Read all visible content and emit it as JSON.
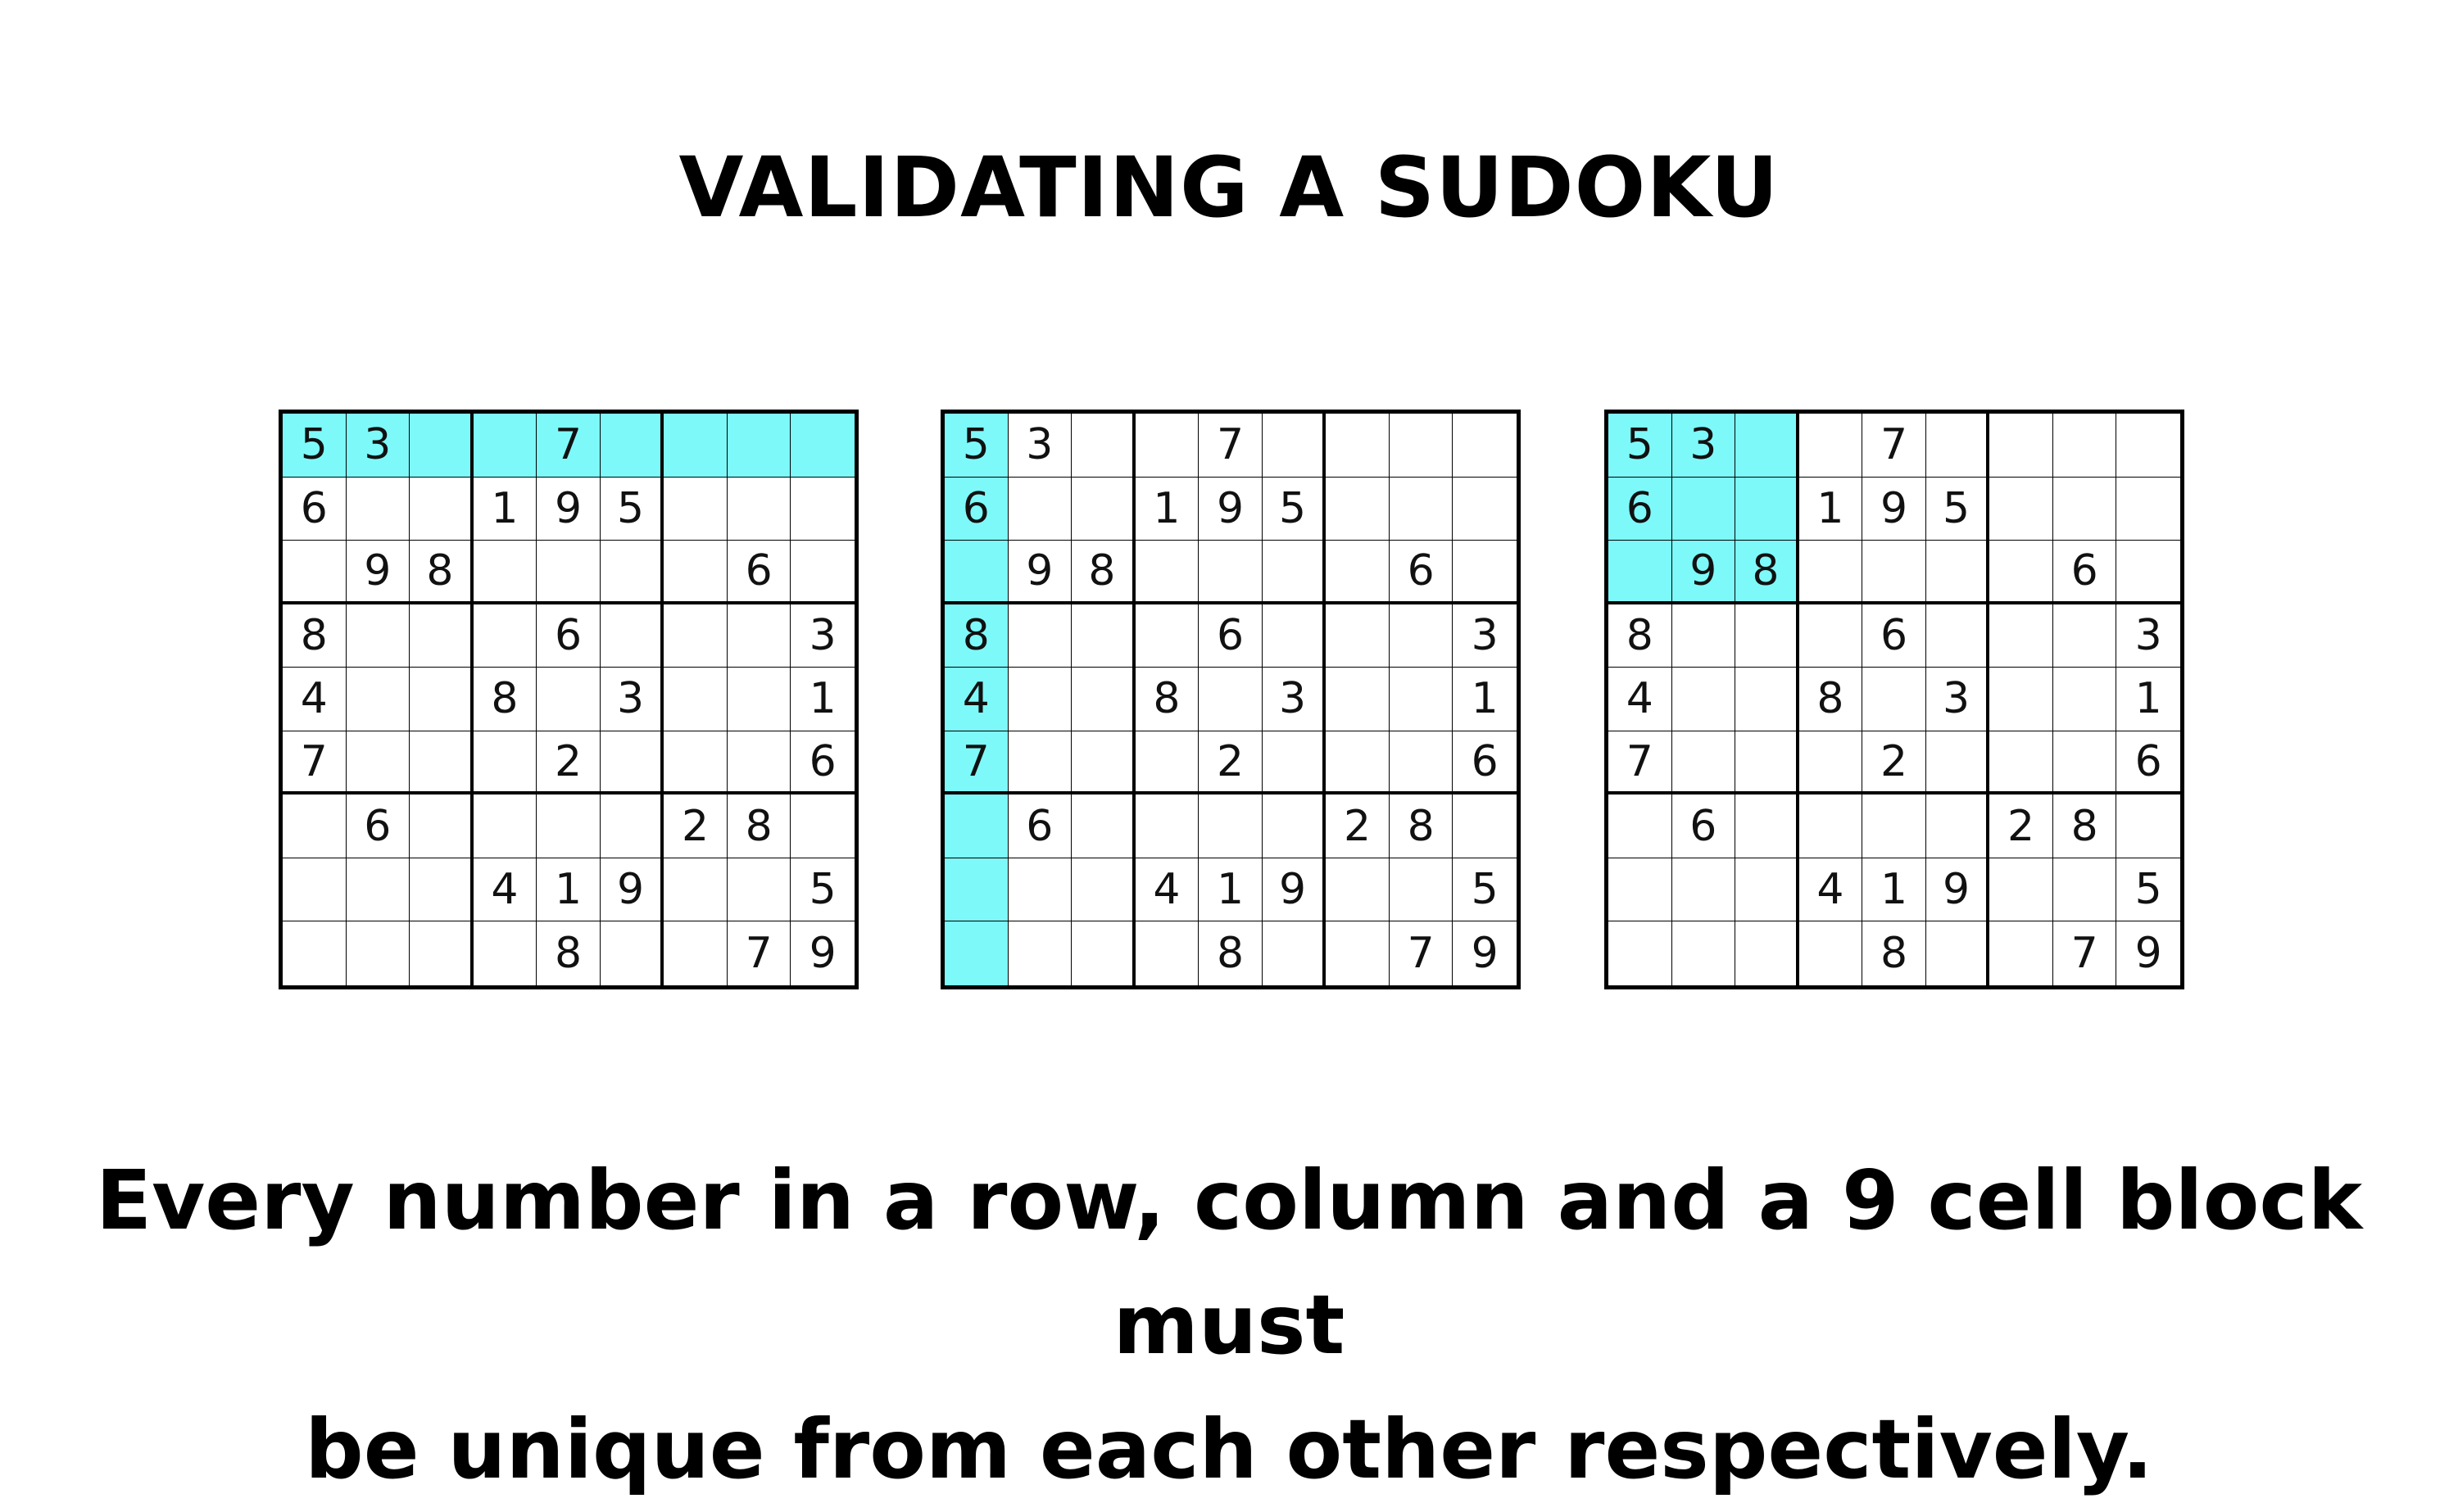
{
  "title": "VALIDATING A SUDOKU",
  "caption_line1": "Every number in a row, column and a 9 cell block must",
  "caption_line2": "be unique from each other respectively.",
  "highlight_color": "#7ef9fa",
  "grid": [
    [
      "5",
      "3",
      "",
      "",
      "7",
      "",
      "",
      "",
      ""
    ],
    [
      "6",
      "",
      "",
      "1",
      "9",
      "5",
      "",
      "",
      ""
    ],
    [
      "",
      "9",
      "8",
      "",
      "",
      "",
      "",
      "6",
      ""
    ],
    [
      "8",
      "",
      "",
      "",
      "6",
      "",
      "",
      "",
      "3"
    ],
    [
      "4",
      "",
      "",
      "8",
      "",
      "3",
      "",
      "",
      "1"
    ],
    [
      "7",
      "",
      "",
      "",
      "2",
      "",
      "",
      "",
      "6"
    ],
    [
      "",
      "6",
      "",
      "",
      "",
      "",
      "2",
      "8",
      ""
    ],
    [
      "",
      "",
      "",
      "4",
      "1",
      "9",
      "",
      "",
      "5"
    ],
    [
      "",
      "",
      "",
      "",
      "8",
      "",
      "",
      "7",
      "9"
    ]
  ],
  "boards": [
    {
      "id": "row",
      "highlight": "row-1"
    },
    {
      "id": "column",
      "highlight": "column-1"
    },
    {
      "id": "block",
      "highlight": "block-1"
    }
  ]
}
